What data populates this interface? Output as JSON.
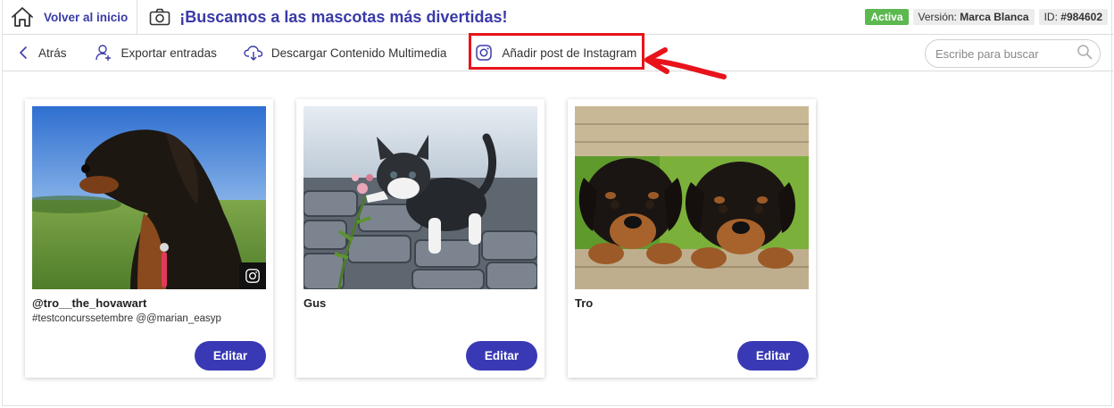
{
  "header": {
    "home_label": "Volver al inicio",
    "title": "¡Buscamos a las mascotas más divertidas!",
    "status_badge": "Activa",
    "version_label": "Versión:",
    "version_value": "Marca Blanca",
    "id_label": "ID:",
    "id_value": "#984602"
  },
  "toolbar": {
    "back_label": "Atrás",
    "export_label": "Exportar entradas",
    "download_label": "Descargar Contenido Multimedia",
    "add_instagram_label": "Añadir post de Instagram",
    "search_placeholder": "Escribe para buscar"
  },
  "cards": [
    {
      "name": "@tro__the_hovawart",
      "description": "#testconcurssetembre @@marian_easyp",
      "edit_label": "Editar",
      "image": "black-tan-dog-on-grass",
      "instagram_badge": true
    },
    {
      "name": "Gus",
      "description": "",
      "edit_label": "Editar",
      "image": "kitten-with-flower",
      "instagram_badge": false
    },
    {
      "name": "Tro",
      "description": "",
      "edit_label": "Editar",
      "image": "two-rottweiler-puppies",
      "instagram_badge": false
    }
  ],
  "colors": {
    "brand": "#3a3aa8",
    "button": "#3939b5",
    "active_badge": "#5cb84f",
    "highlight": "#e8131b"
  },
  "icons": [
    "home-icon",
    "camera-icon",
    "chevron-left-icon",
    "add-user-icon",
    "cloud-download-icon",
    "instagram-icon",
    "search-icon"
  ]
}
